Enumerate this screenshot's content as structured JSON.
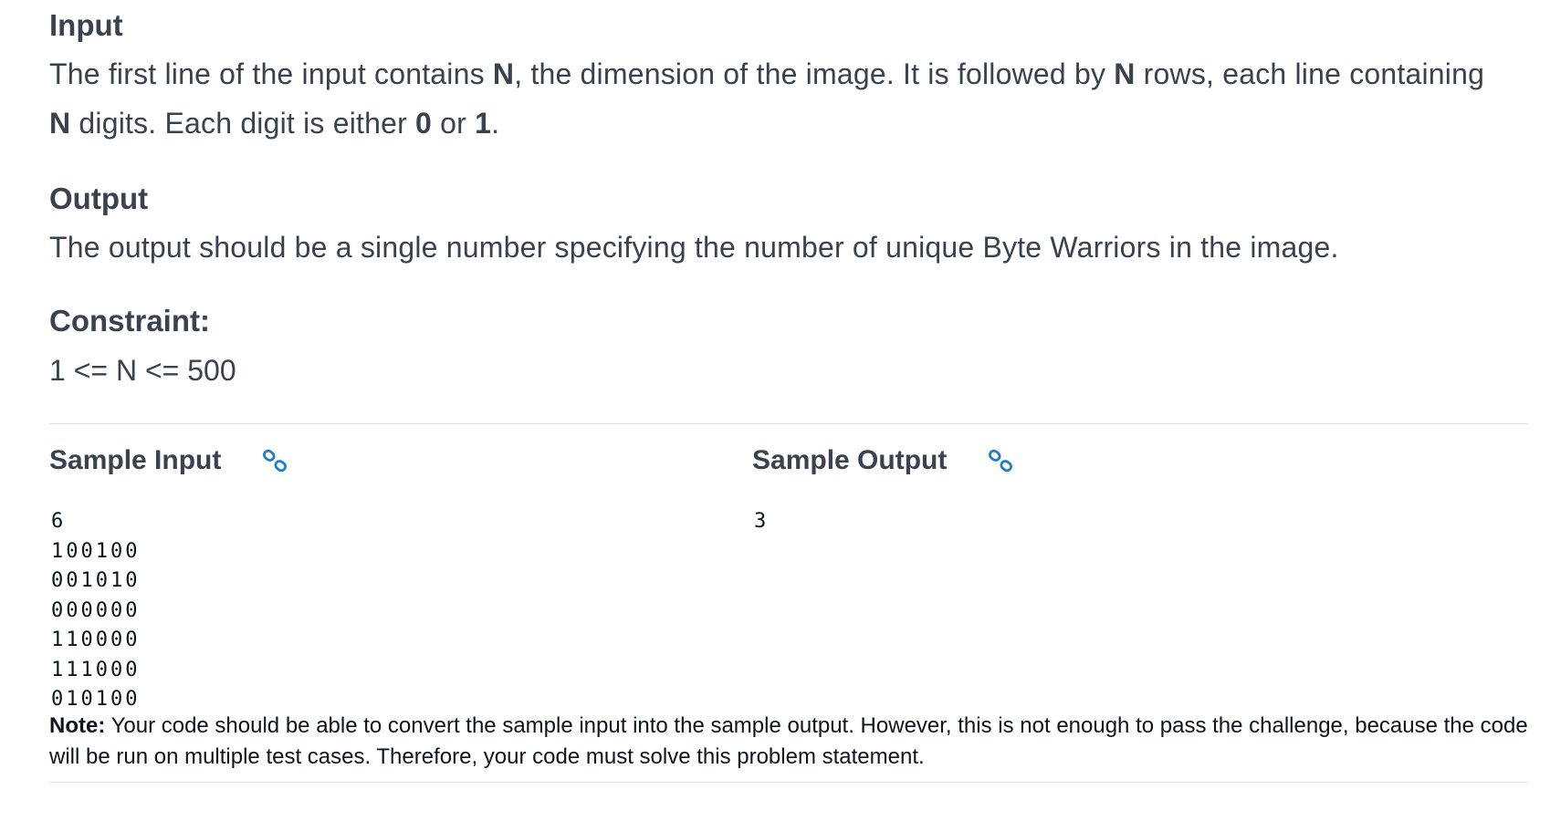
{
  "input_section": {
    "heading": "Input",
    "text_1": "The first line of the input contains ",
    "bold_1": "N",
    "text_2": ", the dimension of the image. It is followed by ",
    "bold_2": "N",
    "text_3": " rows, each line containing ",
    "bold_3": "N",
    "text_4": " digits. Each digit is either ",
    "bold_4": "0",
    "text_5": " or ",
    "bold_5": "1",
    "text_6": "."
  },
  "output_section": {
    "heading": "Output",
    "text": "The output should be a single number specifying the number of unique Byte Warriors in the image."
  },
  "constraint_section": {
    "heading": "Constraint:",
    "value": "1 <= N <= 500"
  },
  "sample_input": {
    "title": "Sample Input",
    "lines": [
      "6",
      "100100",
      "001010",
      "000000",
      "110000",
      "111000",
      "010100"
    ]
  },
  "sample_output": {
    "title": "Sample Output",
    "lines": [
      "3"
    ]
  },
  "note": {
    "label": "Note:",
    "text": " Your code should be able to convert the sample input into the sample output. However, this is not enough to pass the challenge, because the code will be run on multiple test cases. Therefore, your code must solve this problem statement."
  },
  "colors": {
    "text": "#39424e",
    "code": "#0e141e",
    "link_icon": "#1f7dc4",
    "divider": "#dfe2e6"
  }
}
